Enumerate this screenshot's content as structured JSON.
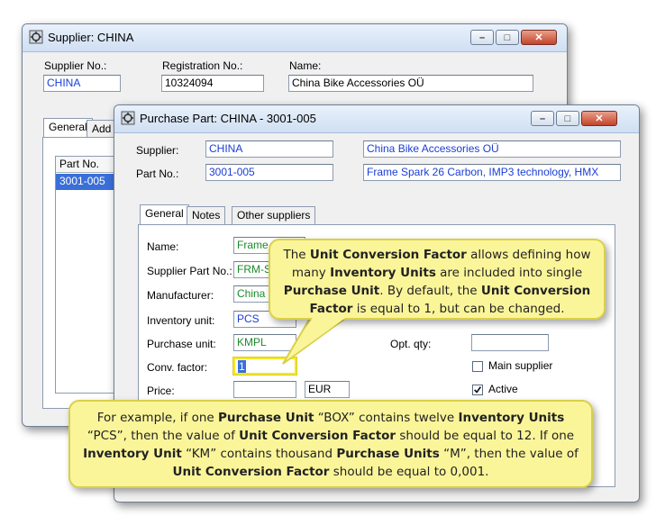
{
  "supplier_window": {
    "title": "Supplier: CHINA",
    "labels": {
      "supplier_no": "Supplier No.:",
      "registration_no": "Registration No.:",
      "name": "Name:"
    },
    "values": {
      "supplier_no": "CHINA",
      "registration_no": "10324094",
      "name": "China Bike Accessories OÜ"
    },
    "tabs": [
      "General",
      "Add"
    ],
    "list": {
      "header": "Part No.",
      "rows": [
        "3001-005"
      ]
    }
  },
  "purchase_window": {
    "title": "Purchase Part: CHINA - 3001-005",
    "labels": {
      "supplier": "Supplier:",
      "part_no": "Part No.:"
    },
    "values": {
      "supplier_code": "CHINA",
      "supplier_name": "China Bike Accessories OÜ",
      "part_no": "3001-005",
      "part_desc": "Frame Spark 26 Carbon, IMP3 technology, HMX"
    },
    "tabs": [
      "General",
      "Notes",
      "Other suppliers"
    ],
    "form": {
      "name_label": "Name:",
      "name_value": "Frame",
      "supplier_part_label": "Supplier Part No.:",
      "supplier_part_value": "FRM-S",
      "manufacturer_label": "Manufacturer:",
      "manufacturer_value": "China",
      "inventory_unit_label": "Inventory unit:",
      "inventory_unit_value": "PCS",
      "purchase_unit_label": "Purchase unit:",
      "purchase_unit_value": "KMPL",
      "conv_factor_label": "Conv. factor:",
      "conv_factor_value": "1",
      "price_label": "Price:",
      "price_value": "",
      "currency_value": "EUR",
      "opt_qty_label": "Opt. qty:",
      "opt_qty_value": "",
      "main_supplier_label": "Main supplier",
      "main_supplier_checked": false,
      "active_label": "Active",
      "active_checked": true
    }
  },
  "callouts": {
    "top": {
      "p1": "The ",
      "b1": "Unit Conversion Factor",
      "p2": " allows defining how many ",
      "b2": "Inventory Units",
      "p3": " are included into single ",
      "b3": "Purchase Unit",
      "p4": ".  By default, the ",
      "b4": "Unit Conversion Factor",
      "p5": " is equal to 1, but can be changed."
    },
    "bottom": {
      "p1": "For example, if one ",
      "b1": "Purchase Unit",
      "p2": " “BOX” contains twelve ",
      "b2": "Inventory Units",
      "p3": " “PCS”, then the value of ",
      "b3": "Unit Conversion Factor",
      "p4": " should be equal to 12.  If one ",
      "b4": "Inventory Unit",
      "p5": " “KM” contains thousand ",
      "b5": "Purchase Units",
      "p6": " “M”, then the value of ",
      "b6": "Unit Conversion Factor",
      "p7": " should be equal to 0,001."
    }
  },
  "colors": {
    "callout_bg": "#fbf59a",
    "highlight": "#f2e820",
    "field_blue": "#1a3dd6",
    "field_green": "#1c8a2a"
  }
}
